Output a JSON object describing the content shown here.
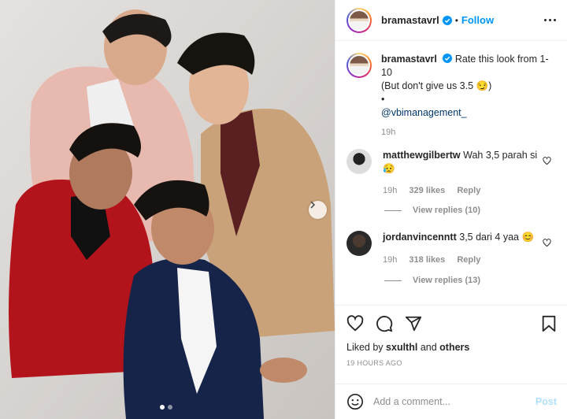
{
  "post": {
    "username": "bramastavrl",
    "follow_label": "Follow",
    "separator": "•"
  },
  "caption": {
    "username": "bramastavrl",
    "text_line1": "Rate this look from 1-",
    "text_line2": "10",
    "text_line3": "(But don't give us 3.5 😏)",
    "bullet": "•",
    "mention": "@vbimanagement_",
    "time": "19h"
  },
  "comments": [
    {
      "username": "matthewgilbertw",
      "text": "Wah 3,5 parah si",
      "emoji": "😥",
      "time": "19h",
      "likes": "329 likes",
      "reply_label": "Reply",
      "view_replies": "View replies (10)"
    },
    {
      "username": "jordanvincenntt",
      "text": "3,5 dari 4 yaa",
      "emoji": "😊",
      "time": "19h",
      "likes": "318 likes",
      "reply_label": "Reply",
      "view_replies": "View replies (13)"
    }
  ],
  "likes": {
    "prefix": "Liked by",
    "user": "sxulthl",
    "and": "and",
    "others": "others"
  },
  "timestamp": "19 HOURS AGO",
  "composer": {
    "placeholder": "Add a comment...",
    "post_label": "Post"
  },
  "carousel": {
    "total": 2,
    "active": 0
  },
  "icons": {
    "verified": "verified-badge-icon",
    "more": "more-options-icon",
    "heart": "heart-icon",
    "comment": "comment-icon",
    "share": "share-icon",
    "save": "bookmark-icon",
    "emoji": "emoji-icon",
    "next": "chevron-right-icon"
  },
  "colors": {
    "link": "#0095f6",
    "verified": "#0095f6",
    "text": "#262626",
    "muted": "#8e8e8e",
    "post_disabled": "#b2dffc"
  }
}
